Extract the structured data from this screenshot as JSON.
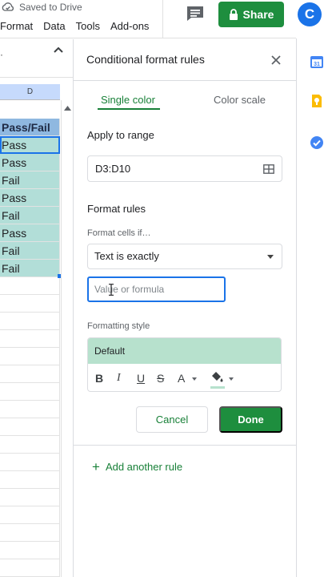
{
  "header": {
    "saved_status": "Saved to Drive",
    "menu": [
      "Format",
      "Data",
      "Tools",
      "Add-ons"
    ],
    "share_label": "Share",
    "avatar_initial": "C"
  },
  "sheet": {
    "toolbar_dots": "·",
    "column_header": "D",
    "cells": [
      "Pass/Fail",
      "Pass",
      "Pass",
      "Fail",
      "Pass",
      "Fail",
      "Pass",
      "Fail",
      "Fail"
    ]
  },
  "panel": {
    "title": "Conditional format rules",
    "tabs": [
      "Single color",
      "Color scale"
    ],
    "apply_label": "Apply to range",
    "range_value": "D3:D10",
    "format_rules_label": "Format rules",
    "format_cells_if_label": "Format cells if…",
    "condition_value": "Text is exactly",
    "value_placeholder": "Value or formula",
    "formatting_style_label": "Formatting style",
    "style_preview": "Default",
    "style_tools": [
      "B",
      "I",
      "U",
      "S",
      "A"
    ],
    "cancel_label": "Cancel",
    "done_label": "Done",
    "add_rule_label": "Add another rule"
  },
  "colors": {
    "accent_green": "#1e8e3e",
    "header_fill": "#8fb8e0",
    "conditional_fill": "#b7e1cd",
    "selection_blue": "#1a73e8"
  }
}
